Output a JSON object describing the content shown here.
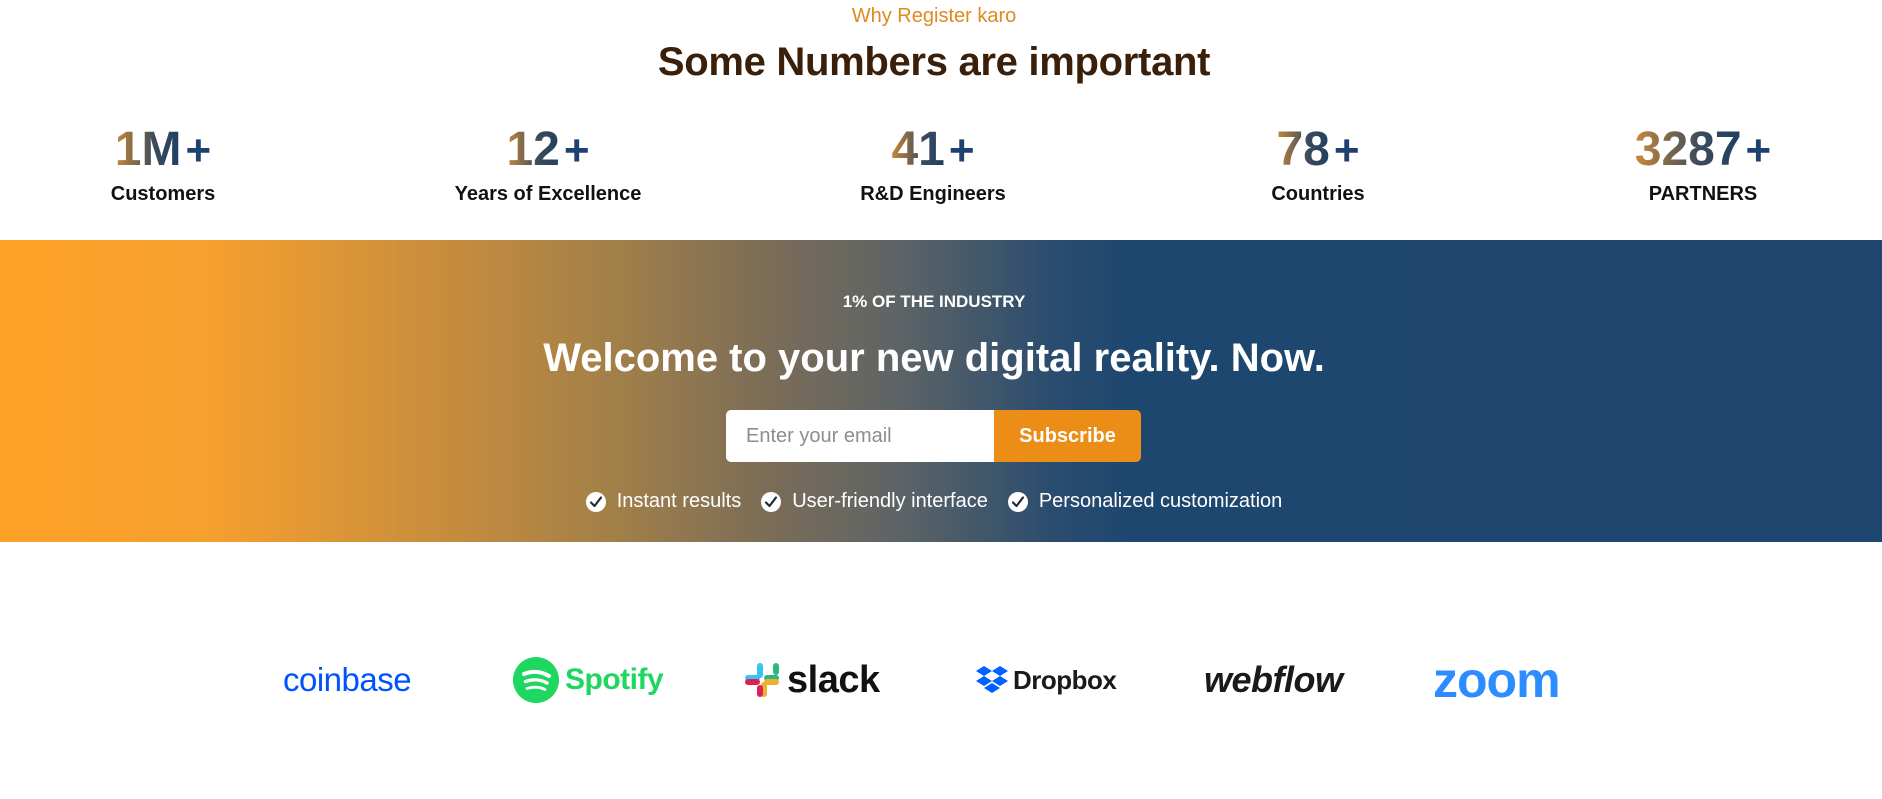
{
  "header": {
    "eyebrow": "Why Register karo",
    "title": "Some Numbers are important"
  },
  "stats": [
    {
      "value": "1M",
      "suffix": "+",
      "label": "Customers"
    },
    {
      "value": "12",
      "suffix": "+",
      "label": "Years of Excellence"
    },
    {
      "value": "41",
      "suffix": "+",
      "label": "R&D Engineers"
    },
    {
      "value": "78",
      "suffix": "+",
      "label": "Countries"
    },
    {
      "value": "3287",
      "suffix": "+",
      "label": "PARTNERS"
    }
  ],
  "cta": {
    "eyebrow": "1% OF THE INDUSTRY",
    "title": "Welcome to your new digital reality. Now.",
    "email_placeholder": "Enter your email",
    "button_label": "Subscribe",
    "features": [
      "Instant results",
      "User-friendly interface",
      "Personalized customization"
    ]
  },
  "logos": {
    "coinbase": "coinbase",
    "spotify": "Spotify",
    "slack": "slack",
    "dropbox": "Dropbox",
    "webflow": "webflow",
    "zoom": "zoom"
  },
  "colors": {
    "accent": "#ec8d17",
    "eyebrow": "#e08a1e",
    "heading": "#3a200a",
    "navy": "#1e466e",
    "coinbase": "#0052ff",
    "spotify": "#1ed760",
    "zoom": "#2d8cff",
    "dropbox": "#0061fe"
  }
}
